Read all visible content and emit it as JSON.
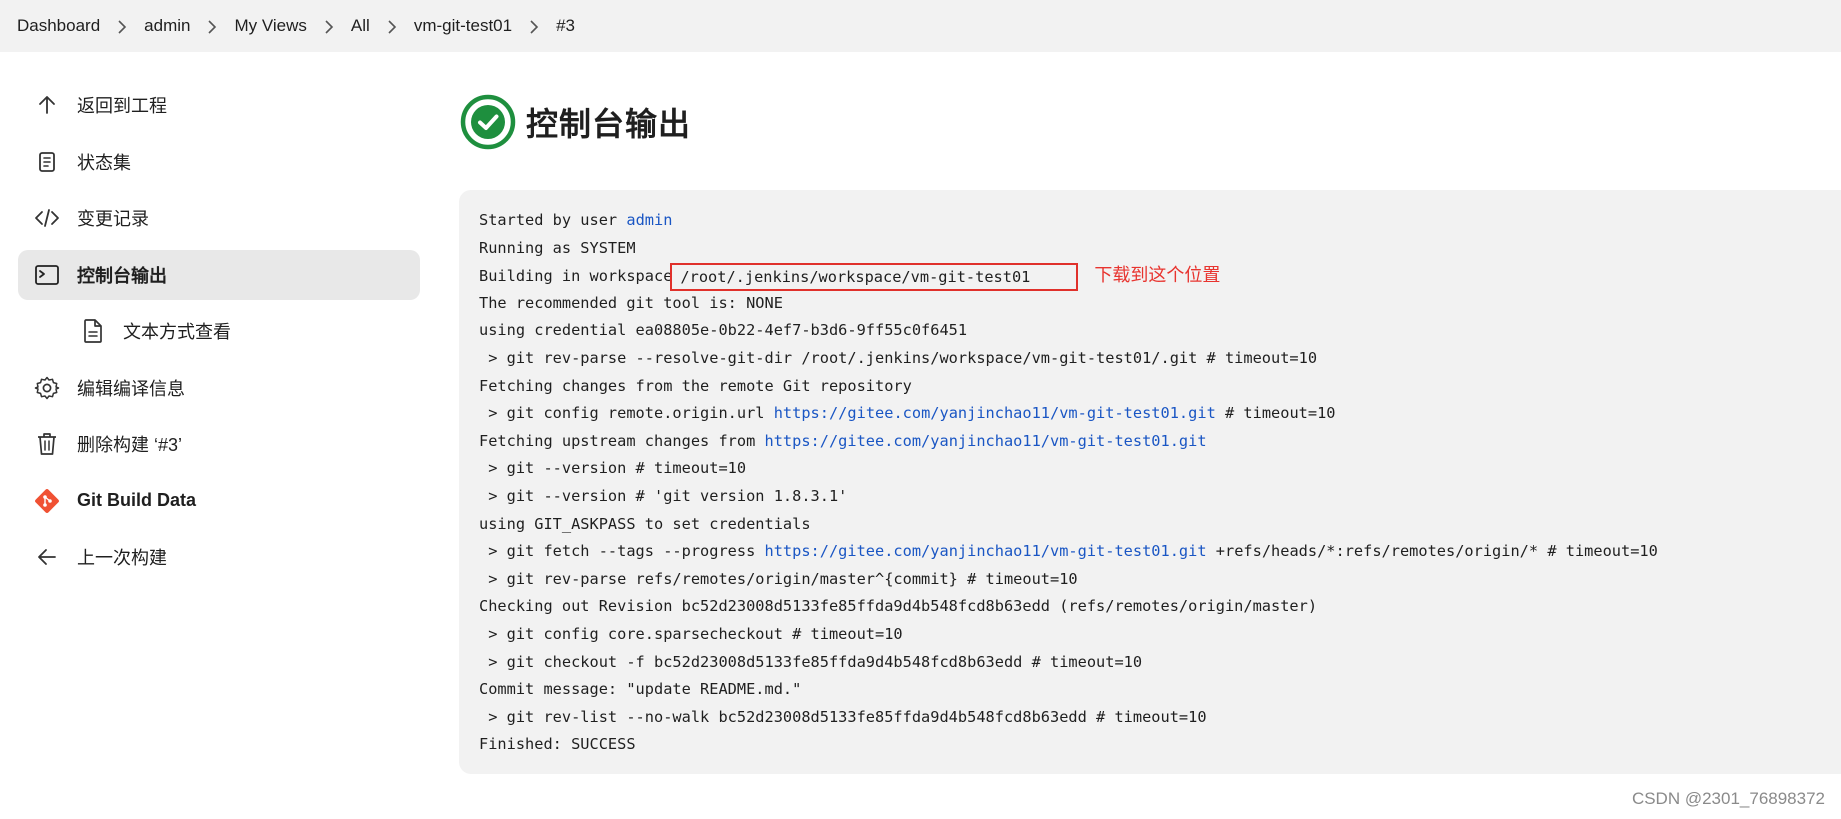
{
  "breadcrumb": [
    "Dashboard",
    "admin",
    "My Views",
    "All",
    "vm-git-test01",
    "#3"
  ],
  "sidebar": {
    "items": [
      {
        "label": "返回到工程",
        "icon": "arrow-up-icon"
      },
      {
        "label": "状态集",
        "icon": "notepad-icon"
      },
      {
        "label": "变更记录",
        "icon": "code-icon"
      },
      {
        "label": "控制台输出",
        "icon": "terminal-icon",
        "active": true
      },
      {
        "label": "文本方式查看",
        "icon": "document-icon",
        "sub": true
      },
      {
        "label": "编辑编译信息",
        "icon": "gear-icon"
      },
      {
        "label": "删除构建 ‘#3’",
        "icon": "trash-icon"
      },
      {
        "label": "Git Build Data",
        "icon": "git-icon"
      },
      {
        "label": "上一次构建",
        "icon": "arrow-left-icon"
      }
    ]
  },
  "page": {
    "title": "控制台输出",
    "status_icon": "success-check-icon",
    "status_color": "#1e8f3e"
  },
  "console": {
    "started_prefix": "Started by user ",
    "started_user": "admin",
    "running_as": "Running as SYSTEM",
    "workspace_prefix": "Building in workspace",
    "workspace_path": "/root/.jenkins/workspace/vm-git-test01",
    "annotation": "下载到这个位置",
    "git_tool": "The recommended git tool is: NONE",
    "credential": "using credential ea08805e-0b22-4ef7-b3d6-9ff55c0f6451",
    "rev_parse_dir": " > git rev-parse --resolve-git-dir /root/.jenkins/workspace/vm-git-test01/.git # timeout=10",
    "fetching_remote": "Fetching changes from the remote Git repository",
    "config_prefix": " > git config remote.origin.url ",
    "repo_url": "https://gitee.com/yanjinchao11/vm-git-test01.git",
    "config_suffix": " # timeout=10",
    "fetching_upstream_prefix": "Fetching upstream changes from ",
    "git_version_timeout": " > git --version # timeout=10",
    "git_version_result": " > git --version # 'git version 1.8.3.1'",
    "askpass": "using GIT_ASKPASS to set credentials",
    "fetch_prefix": " > git fetch --tags --progress ",
    "fetch_suffix": " +refs/heads/*:refs/remotes/origin/* # timeout=10",
    "rev_parse_commit": " > git rev-parse refs/remotes/origin/master^{commit} # timeout=10",
    "checking_out": "Checking out Revision bc52d23008d5133fe85ffda9d4b548fcd8b63edd (refs/remotes/origin/master)",
    "sparse": " > git config core.sparsecheckout # timeout=10",
    "checkout": " > git checkout -f bc52d23008d5133fe85ffda9d4b548fcd8b63edd # timeout=10",
    "commit_message": "Commit message: \"update README.md.\"",
    "rev_list": " > git rev-list --no-walk bc52d23008d5133fe85ffda9d4b548fcd8b63edd # timeout=10",
    "finished": "Finished: SUCCESS"
  },
  "watermark": "CSDN @2301_76898372",
  "colors": {
    "link": "#1a56c4",
    "annotation": "#e8342f",
    "success": "#1e8f3e",
    "git_brand": "#f05133"
  }
}
